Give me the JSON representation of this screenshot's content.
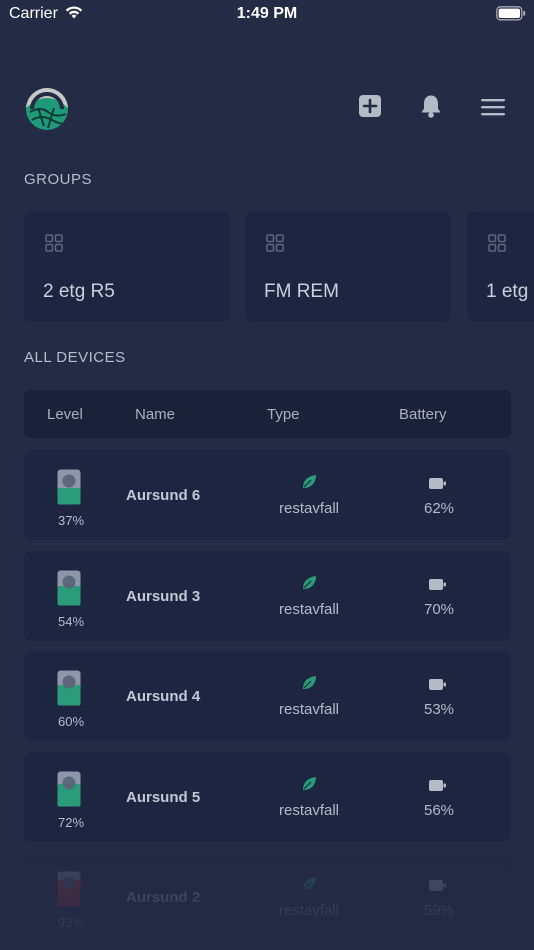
{
  "status_bar": {
    "carrier": "Carrier",
    "time": "1:49 PM"
  },
  "header": {
    "logo_icon": "app-logo-icon",
    "add_icon": "add-square-icon",
    "bell_icon": "bell-icon",
    "menu_icon": "hamburger-menu-icon"
  },
  "groups": {
    "title": "GROUPS",
    "items": [
      {
        "name": "2 etg R5",
        "icon": "grid-icon"
      },
      {
        "name": "FM REM",
        "icon": "grid-icon"
      },
      {
        "name": "1 etg",
        "icon": "grid-icon"
      }
    ]
  },
  "devices": {
    "title": "ALL DEVICES",
    "columns": {
      "level": "Level",
      "name": "Name",
      "type": "Type",
      "battery": "Battery"
    },
    "rows": [
      {
        "level": 0.37,
        "level_label": "37%",
        "name": "Aursund 6",
        "type": "restavfall",
        "battery": "62%",
        "fill_color": "#2a9c79"
      },
      {
        "level": 0.54,
        "level_label": "54%",
        "name": "Aursund 3",
        "type": "restavfall",
        "battery": "70%",
        "fill_color": "#2a9c79"
      },
      {
        "level": 0.6,
        "level_label": "60%",
        "name": "Aursund 4",
        "type": "restavfall",
        "battery": "53%",
        "fill_color": "#2a9c79"
      },
      {
        "level": 0.72,
        "level_label": "72%",
        "name": "Aursund 5",
        "type": "restavfall",
        "battery": "56%",
        "fill_color": "#2a9c79"
      },
      {
        "level": 0.93,
        "level_label": "93%",
        "name": "Aursund 2",
        "type": "restavfall",
        "battery": "59%",
        "fill_color": "#c0333d"
      }
    ]
  },
  "colors": {
    "background": "#232b45",
    "card": "#1d2540",
    "accent_green": "#2a9c79",
    "alert_red": "#c0333d"
  }
}
